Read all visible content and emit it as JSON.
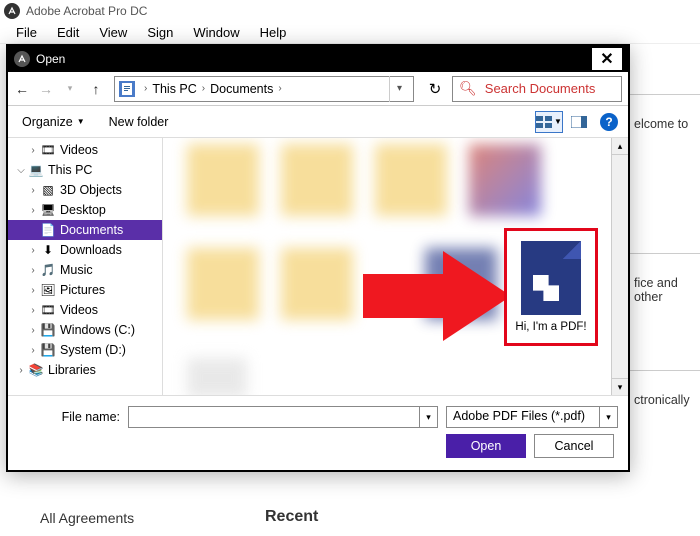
{
  "app": {
    "title": "Adobe Acrobat Pro DC"
  },
  "menu": {
    "items": [
      "File",
      "Edit",
      "View",
      "Sign",
      "Window",
      "Help"
    ]
  },
  "dialog": {
    "title": "Open",
    "breadcrumb": {
      "root": "This PC",
      "folder": "Documents"
    },
    "search_placeholder": "Search Documents",
    "toolbar": {
      "organize": "Organize",
      "new_folder": "New folder"
    },
    "tree": [
      {
        "label": "Videos",
        "level": 2,
        "expander": ">",
        "icon": "videos"
      },
      {
        "label": "This PC",
        "level": 1,
        "expander": "v",
        "icon": "pc"
      },
      {
        "label": "3D Objects",
        "level": 2,
        "expander": ">",
        "icon": "3d"
      },
      {
        "label": "Desktop",
        "level": 2,
        "expander": ">",
        "icon": "desktop"
      },
      {
        "label": "Documents",
        "level": 2,
        "expander": "",
        "icon": "docs",
        "selected": true
      },
      {
        "label": "Downloads",
        "level": 2,
        "expander": ">",
        "icon": "downloads"
      },
      {
        "label": "Music",
        "level": 2,
        "expander": ">",
        "icon": "music"
      },
      {
        "label": "Pictures",
        "level": 2,
        "expander": ">",
        "icon": "pictures"
      },
      {
        "label": "Videos",
        "level": 2,
        "expander": ">",
        "icon": "videos"
      },
      {
        "label": "Windows (C:)",
        "level": 2,
        "expander": ">",
        "icon": "drive"
      },
      {
        "label": "System (D:)",
        "level": 2,
        "expander": ">",
        "icon": "drive"
      },
      {
        "label": "Libraries",
        "level": 1,
        "expander": ">",
        "icon": "libs"
      }
    ],
    "highlight_file": "Hi, I'm a PDF!",
    "footer": {
      "filename_label": "File name:",
      "filename_value": "",
      "filetype": "Adobe PDF Files (*.pdf)",
      "open": "Open",
      "cancel": "Cancel"
    }
  },
  "background": {
    "welcome": "elcome to",
    "office": "fice and other",
    "electronically": "ctronically",
    "all_agreements": "All Agreements",
    "recent": "Recent"
  }
}
